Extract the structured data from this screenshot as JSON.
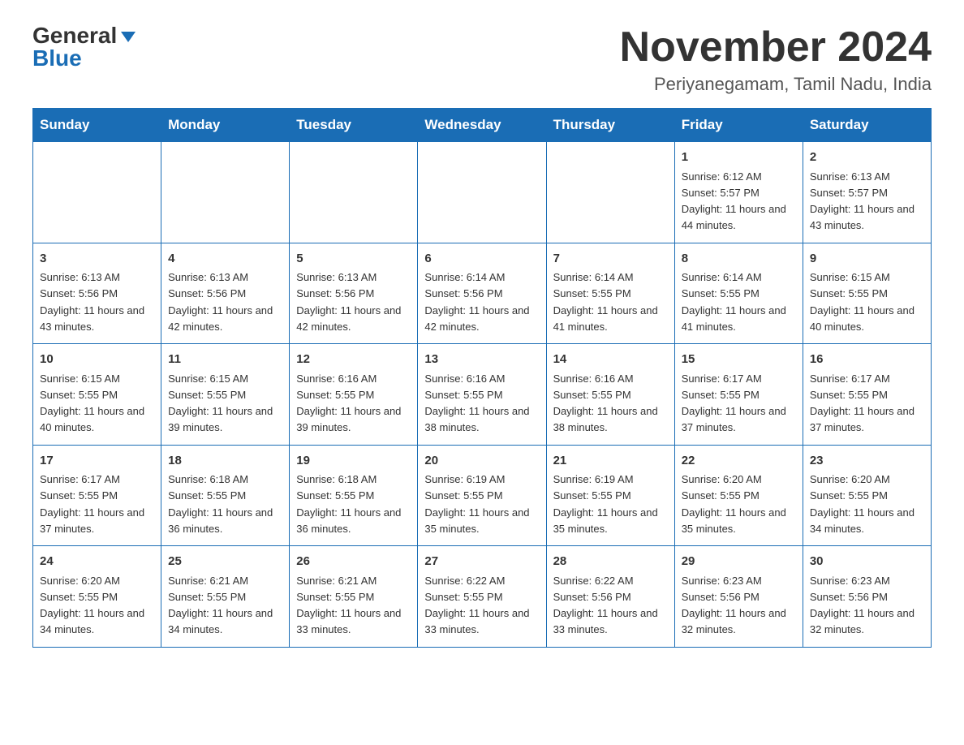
{
  "header": {
    "logo": {
      "general": "General",
      "blue": "Blue",
      "alt": "GeneralBlue Logo"
    },
    "title": "November 2024",
    "location": "Periyanegamam, Tamil Nadu, India"
  },
  "calendar": {
    "days_of_week": [
      "Sunday",
      "Monday",
      "Tuesday",
      "Wednesday",
      "Thursday",
      "Friday",
      "Saturday"
    ],
    "weeks": [
      [
        {
          "date": "",
          "info": ""
        },
        {
          "date": "",
          "info": ""
        },
        {
          "date": "",
          "info": ""
        },
        {
          "date": "",
          "info": ""
        },
        {
          "date": "",
          "info": ""
        },
        {
          "date": "1",
          "info": "Sunrise: 6:12 AM\nSunset: 5:57 PM\nDaylight: 11 hours\nand 44 minutes."
        },
        {
          "date": "2",
          "info": "Sunrise: 6:13 AM\nSunset: 5:57 PM\nDaylight: 11 hours\nand 43 minutes."
        }
      ],
      [
        {
          "date": "3",
          "info": "Sunrise: 6:13 AM\nSunset: 5:56 PM\nDaylight: 11 hours\nand 43 minutes."
        },
        {
          "date": "4",
          "info": "Sunrise: 6:13 AM\nSunset: 5:56 PM\nDaylight: 11 hours\nand 42 minutes."
        },
        {
          "date": "5",
          "info": "Sunrise: 6:13 AM\nSunset: 5:56 PM\nDaylight: 11 hours\nand 42 minutes."
        },
        {
          "date": "6",
          "info": "Sunrise: 6:14 AM\nSunset: 5:56 PM\nDaylight: 11 hours\nand 42 minutes."
        },
        {
          "date": "7",
          "info": "Sunrise: 6:14 AM\nSunset: 5:55 PM\nDaylight: 11 hours\nand 41 minutes."
        },
        {
          "date": "8",
          "info": "Sunrise: 6:14 AM\nSunset: 5:55 PM\nDaylight: 11 hours\nand 41 minutes."
        },
        {
          "date": "9",
          "info": "Sunrise: 6:15 AM\nSunset: 5:55 PM\nDaylight: 11 hours\nand 40 minutes."
        }
      ],
      [
        {
          "date": "10",
          "info": "Sunrise: 6:15 AM\nSunset: 5:55 PM\nDaylight: 11 hours\nand 40 minutes."
        },
        {
          "date": "11",
          "info": "Sunrise: 6:15 AM\nSunset: 5:55 PM\nDaylight: 11 hours\nand 39 minutes."
        },
        {
          "date": "12",
          "info": "Sunrise: 6:16 AM\nSunset: 5:55 PM\nDaylight: 11 hours\nand 39 minutes."
        },
        {
          "date": "13",
          "info": "Sunrise: 6:16 AM\nSunset: 5:55 PM\nDaylight: 11 hours\nand 38 minutes."
        },
        {
          "date": "14",
          "info": "Sunrise: 6:16 AM\nSunset: 5:55 PM\nDaylight: 11 hours\nand 38 minutes."
        },
        {
          "date": "15",
          "info": "Sunrise: 6:17 AM\nSunset: 5:55 PM\nDaylight: 11 hours\nand 37 minutes."
        },
        {
          "date": "16",
          "info": "Sunrise: 6:17 AM\nSunset: 5:55 PM\nDaylight: 11 hours\nand 37 minutes."
        }
      ],
      [
        {
          "date": "17",
          "info": "Sunrise: 6:17 AM\nSunset: 5:55 PM\nDaylight: 11 hours\nand 37 minutes."
        },
        {
          "date": "18",
          "info": "Sunrise: 6:18 AM\nSunset: 5:55 PM\nDaylight: 11 hours\nand 36 minutes."
        },
        {
          "date": "19",
          "info": "Sunrise: 6:18 AM\nSunset: 5:55 PM\nDaylight: 11 hours\nand 36 minutes."
        },
        {
          "date": "20",
          "info": "Sunrise: 6:19 AM\nSunset: 5:55 PM\nDaylight: 11 hours\nand 35 minutes."
        },
        {
          "date": "21",
          "info": "Sunrise: 6:19 AM\nSunset: 5:55 PM\nDaylight: 11 hours\nand 35 minutes."
        },
        {
          "date": "22",
          "info": "Sunrise: 6:20 AM\nSunset: 5:55 PM\nDaylight: 11 hours\nand 35 minutes."
        },
        {
          "date": "23",
          "info": "Sunrise: 6:20 AM\nSunset: 5:55 PM\nDaylight: 11 hours\nand 34 minutes."
        }
      ],
      [
        {
          "date": "24",
          "info": "Sunrise: 6:20 AM\nSunset: 5:55 PM\nDaylight: 11 hours\nand 34 minutes."
        },
        {
          "date": "25",
          "info": "Sunrise: 6:21 AM\nSunset: 5:55 PM\nDaylight: 11 hours\nand 34 minutes."
        },
        {
          "date": "26",
          "info": "Sunrise: 6:21 AM\nSunset: 5:55 PM\nDaylight: 11 hours\nand 33 minutes."
        },
        {
          "date": "27",
          "info": "Sunrise: 6:22 AM\nSunset: 5:55 PM\nDaylight: 11 hours\nand 33 minutes."
        },
        {
          "date": "28",
          "info": "Sunrise: 6:22 AM\nSunset: 5:56 PM\nDaylight: 11 hours\nand 33 minutes."
        },
        {
          "date": "29",
          "info": "Sunrise: 6:23 AM\nSunset: 5:56 PM\nDaylight: 11 hours\nand 32 minutes."
        },
        {
          "date": "30",
          "info": "Sunrise: 6:23 AM\nSunset: 5:56 PM\nDaylight: 11 hours\nand 32 minutes."
        }
      ]
    ]
  }
}
